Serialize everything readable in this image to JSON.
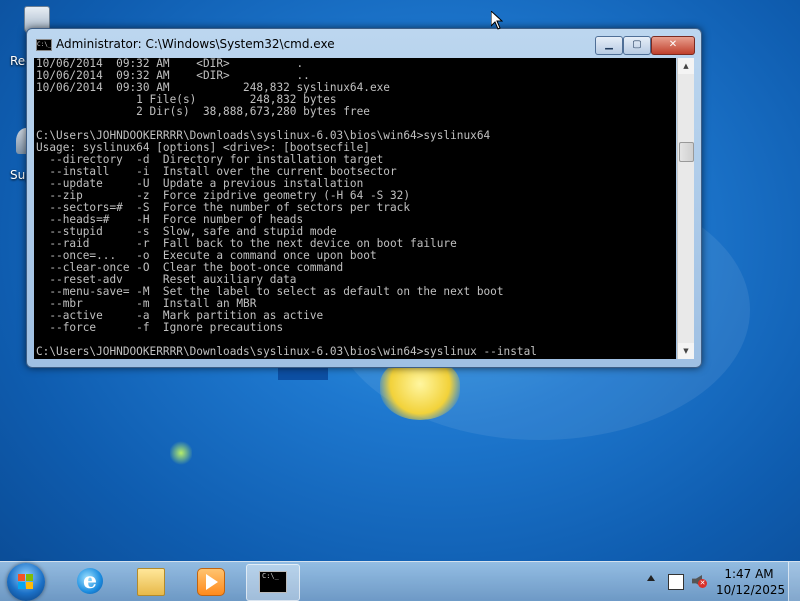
{
  "desktop": {
    "icons": [
      {
        "label": "Rec",
        "icon": "recycle-bin-icon"
      },
      {
        "label": "Sup",
        "icon": "support-icon"
      }
    ]
  },
  "window": {
    "title": "Administrator: C:\\Windows\\System32\\cmd.exe",
    "icon": "cmd-icon",
    "minimize_glyph": "▁",
    "maximize_glyph": "▢",
    "close_glyph": "✕",
    "console_lines": [
      "10/06/2014  09:32 AM    <DIR>          .",
      "10/06/2014  09:32 AM    <DIR>          ..",
      "10/06/2014  09:30 AM           248,832 syslinux64.exe",
      "               1 File(s)        248,832 bytes",
      "               2 Dir(s)  38,888,673,280 bytes free",
      "",
      "C:\\Users\\JOHNDOOKERRRR\\Downloads\\syslinux-6.03\\bios\\win64>syslinux64",
      "Usage: syslinux64 [options] <drive>: [bootsecfile]",
      "  --directory  -d  Directory for installation target",
      "  --install    -i  Install over the current bootsector",
      "  --update     -U  Update a previous installation",
      "  --zip        -z  Force zipdrive geometry (-H 64 -S 32)",
      "  --sectors=#  -S  Force the number of sectors per track",
      "  --heads=#    -H  Force number of heads",
      "  --stupid     -s  Slow, safe and stupid mode",
      "  --raid       -r  Fall back to the next device on boot failure",
      "  --once=...   -o  Execute a command once upon boot",
      "  --clear-once -O  Clear the boot-once command",
      "  --reset-adv      Reset auxiliary data",
      "  --menu-save= -M  Set the label to select as default on the next boot",
      "  --mbr        -m  Install an MBR",
      "  --active     -a  Mark partition as active",
      "  --force      -f  Ignore precautions",
      "",
      "C:\\Users\\JOHNDOOKERRRR\\Downloads\\syslinux-6.03\\bios\\win64>syslinux --instal"
    ]
  },
  "taskbar": {
    "pinned": [
      {
        "name": "internet-explorer",
        "icon": "internet-explorer-icon"
      },
      {
        "name": "windows-explorer",
        "icon": "folder-icon"
      },
      {
        "name": "windows-media-player",
        "icon": "media-player-icon"
      },
      {
        "name": "command-prompt",
        "icon": "cmd-icon",
        "active": true
      }
    ],
    "cmd_icon_text": "C:\\_",
    "clock": {
      "time": "1:47 AM",
      "date": "10/12/2025"
    }
  },
  "colors": {
    "console_bg": "#000000",
    "console_fg": "#c0c0c0",
    "desktop_blue": "#1e78cf"
  }
}
